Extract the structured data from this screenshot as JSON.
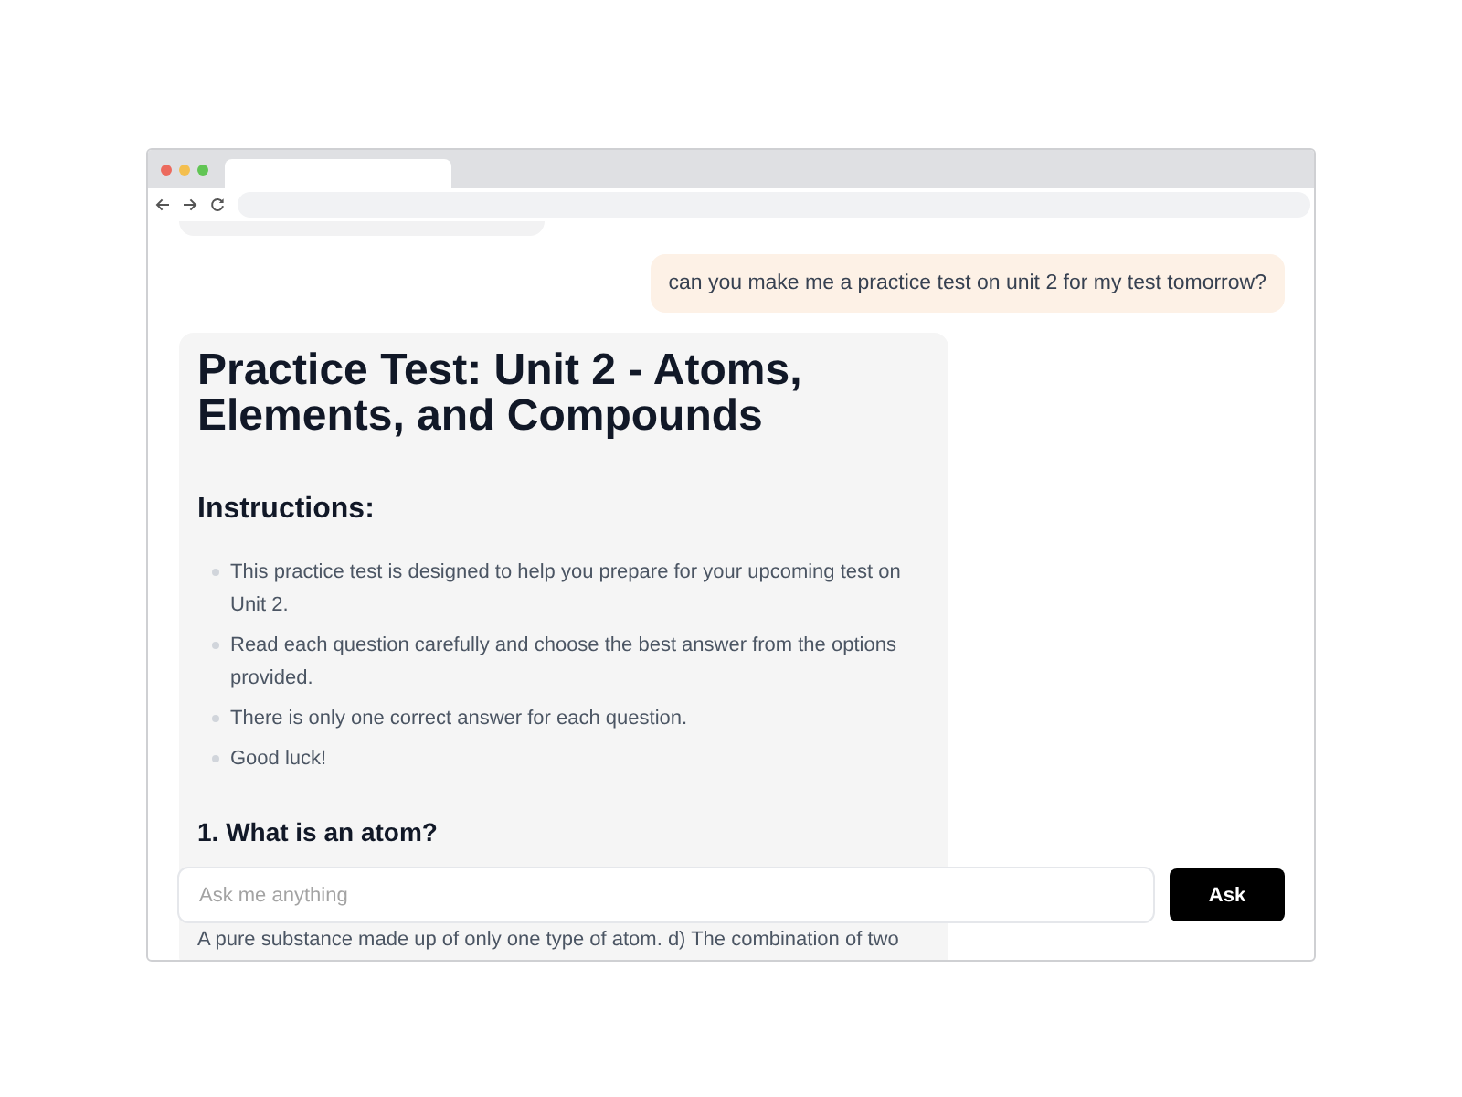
{
  "chat": {
    "messages": [
      {
        "kind": "user",
        "text": "can you make me a practice test on unit 2 for my test tomorrow?"
      },
      {
        "kind": "assistant",
        "blocks": [
          {
            "kind": "h1",
            "text": "Practice Test: Unit 2 - Atoms, Elements, and Compounds"
          },
          {
            "kind": "h2",
            "text": "Instructions:"
          },
          {
            "kind": "list",
            "items": [
              "This practice test is designed to help you prepare for your upcoming test on Unit 2.",
              "Read each question carefully and choose the best answer from the options provided.",
              "There is only one correct answer for each question.",
              "Good luck!"
            ]
          },
          {
            "kind": "h3",
            "text": "1. What is an atom?"
          },
          {
            "kind": "p",
            "text": "A pure substance made up of only one type of atom. d) The combination of two"
          }
        ]
      }
    ]
  },
  "composer": {
    "placeholder": "Ask me anything",
    "button": "Ask"
  }
}
